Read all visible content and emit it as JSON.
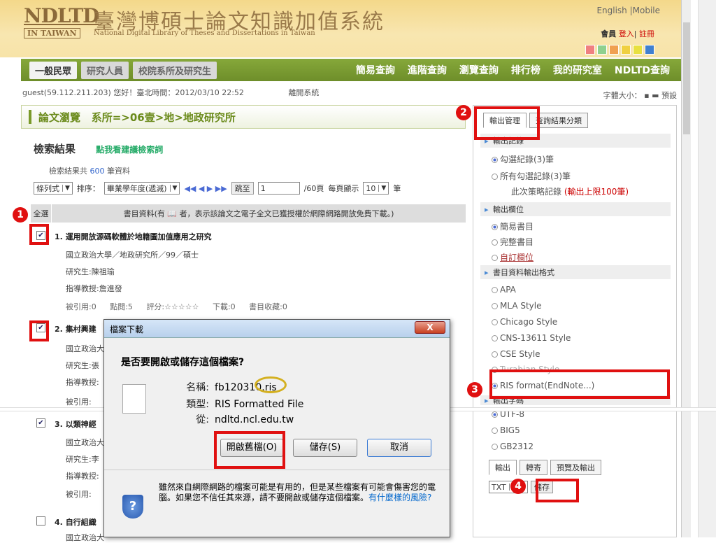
{
  "header": {
    "logo_abbr": "NDLTD",
    "logo_cn": "臺灣博碩士論文知識加值系統",
    "logo_tw": "IN TAIWAN",
    "logo_en": "National Digital Library of Theses and Dissertations in Taiwan",
    "toplinks": "English |Mobile",
    "member_label": "會員",
    "login": "登入",
    "sep": "|",
    "register": "註冊",
    "swatches": [
      "#f08080",
      "#8fd08f",
      "#f0a050",
      "#f0d040",
      "#e8e040",
      "#4080d0"
    ]
  },
  "nav": {
    "tabs": [
      "一般民眾",
      "研究人員",
      "校院系所及研究生"
    ],
    "links": [
      "簡易查詢",
      "進階查詢",
      "瀏覽查詢",
      "排行榜",
      "我的研究室",
      "NDLTD查詢"
    ]
  },
  "status": {
    "guest": "guest(59.112.211.203) 您好！臺北時間：2012/03/10 22:52",
    "leave": "離開系統",
    "fontsize": "字體大小：",
    "f1": "▪",
    "f2": "▬",
    "f3": "預設"
  },
  "main": {
    "browse_label": "論文瀏覽",
    "browse_path": "系所=>06壹>地>地政研究所",
    "result_title": "檢索結果",
    "hint": "點我看建議檢索詞",
    "count_pre": "檢索結果共",
    "count_num": "600",
    "count_post": "筆資料",
    "view_mode": "條列式",
    "sort_label": "排序：",
    "sort_value": "畢業學年度(遞減)",
    "nav_arrows": "◀◀ ◀ ▶ ▶▶",
    "jump": "跳至",
    "page_value": "1",
    "pages": "/60頁",
    "per_page_label": "每頁顯示",
    "per_page": "10",
    "per_page_unit": "筆",
    "select_all": "全選",
    "list_desc": "書目資料(有 📖 者，表示該論文之電子全文已獲授權於網際網路開放免費下載。)",
    "records": [
      {
        "n": "1.",
        "title": "運用開放源碼軟體於地籍圖加值應用之研究",
        "school": "國立政治大學／地政研究所／99／碩士",
        "student": "研究生:陳祖瑜",
        "advisor": "指導教授:詹進發",
        "cited": "被引用:0",
        "clicks": "點閱:5",
        "rating": "評分:☆☆☆☆☆",
        "downloads": "下載:0",
        "saved": "書目收藏:0"
      },
      {
        "n": "2.",
        "title": "集村興建",
        "school": "國立政治大",
        "student": "研究生:張",
        "advisor": "指導教授:",
        "cited": "被引用:"
      },
      {
        "n": "3.",
        "title": "以類神經",
        "school": "國立政治大",
        "student": "研究生:李",
        "advisor": "指導教授:",
        "cited": "被引用:"
      },
      {
        "n": "4.",
        "title": "自行組織",
        "school": "國立政治大"
      }
    ]
  },
  "sidebar": {
    "tab1": "輸出管理",
    "tab2": "查詢結果分類",
    "sec_records": "輸出記錄",
    "opt_checked": "勾選紀錄(3)筆",
    "opt_all": "所有勾選記錄(3)筆",
    "opt_note_pre": "此次策略記錄",
    "opt_note_warn": "(輸出上限100筆)",
    "sec_fields": "輸出欄位",
    "f_simple": "簡易書目",
    "f_full": "完整書目",
    "f_custom": "自訂欄位",
    "sec_format": "書目資料輸出格式",
    "fmt": [
      "APA",
      "MLA Style",
      "Chicago Style",
      "CNS-13611 Style",
      "CSE Style",
      "Turabian Style",
      "RIS format(EndNote...)"
    ],
    "sec_encoding": "輸出字碼",
    "enc": [
      "UTF-8",
      "BIG5",
      "GB2312"
    ],
    "out_tabs": [
      "輸出",
      "轉寄",
      "預覽及輸出"
    ],
    "out_format": "TXT",
    "save_btn": "儲存"
  },
  "dialog": {
    "title": "檔案下載",
    "close": "X",
    "question": "是否要開啟或儲存這個檔案?",
    "name_k": "名稱:",
    "name_v": "fb120310.ris",
    "type_k": "類型:",
    "type_v": "RIS Formatted File",
    "from_k": "從:",
    "from_v": "ndltd.ncl.edu.tw",
    "open": "開啟舊檔(O)",
    "save": "儲存(S)",
    "cancel": "取消",
    "warning": "雖然來自網際網路的檔案可能是有用的，但是某些檔案有可能會傷害您的電腦。如果您不信任其來源，請不要開啟或儲存這個檔案。",
    "risk_link": "有什麼樣的風險?"
  },
  "markers": [
    "1",
    "2",
    "3",
    "4"
  ]
}
